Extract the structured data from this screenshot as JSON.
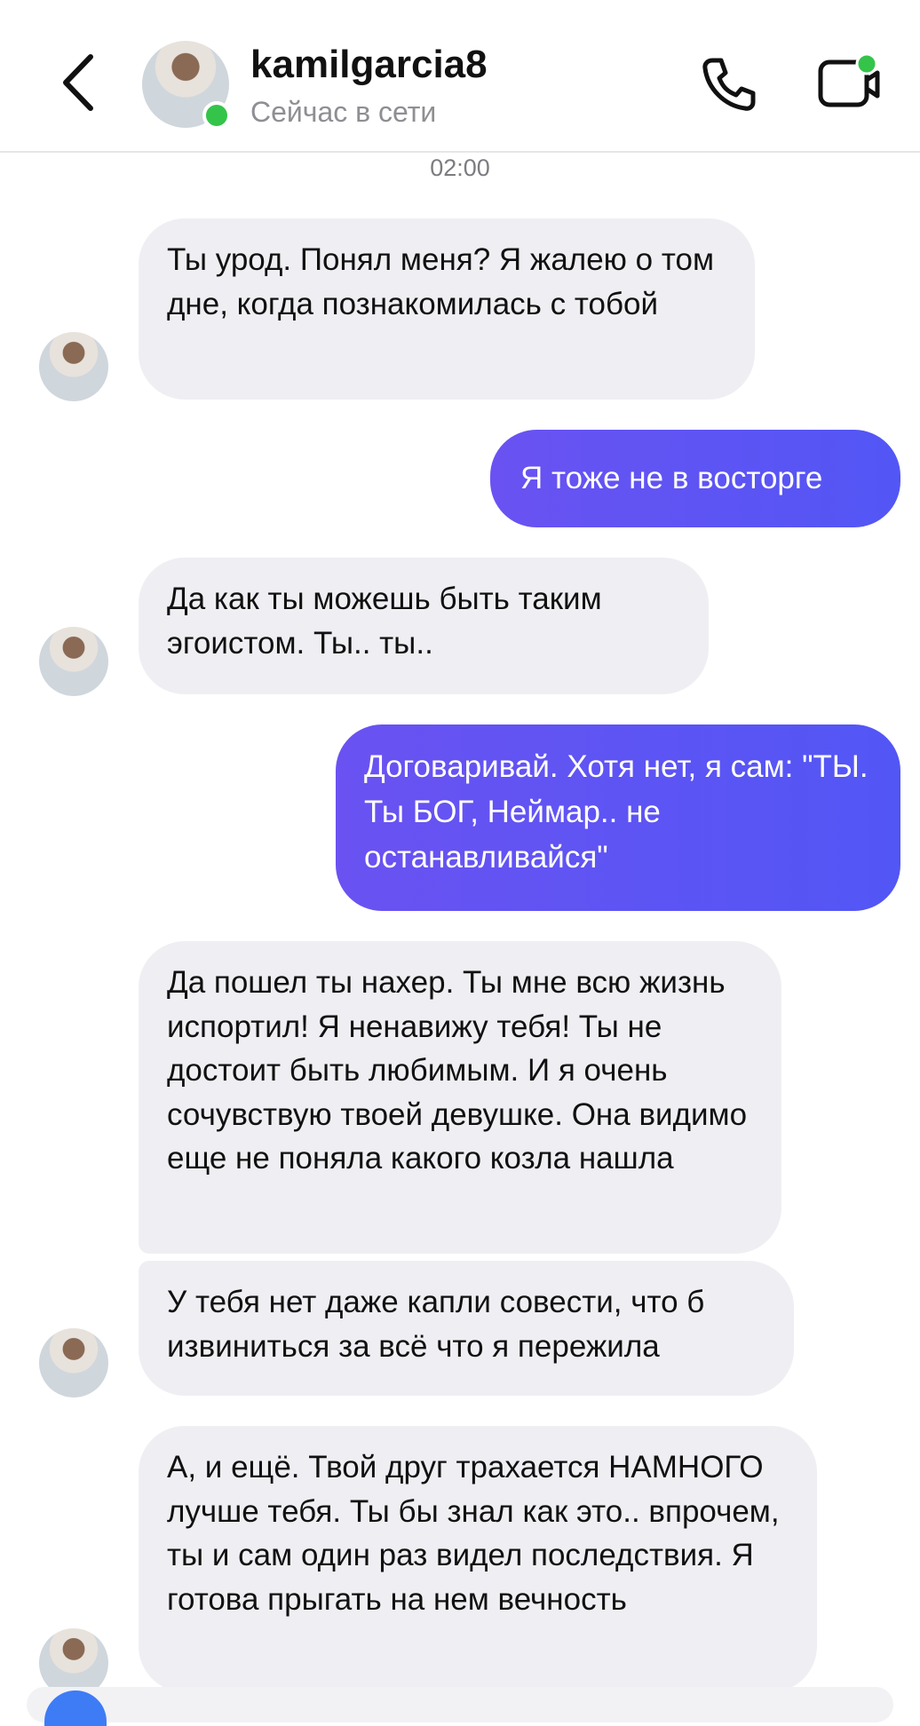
{
  "header": {
    "username": "kamilgarcia8",
    "status": "Сейчас в сети",
    "online_color": "#34c44a",
    "icons": [
      "chevron-left-icon",
      "phone-icon",
      "video-call-icon"
    ]
  },
  "chat": {
    "timestamp": "02:00",
    "messages": [
      {
        "from": "them",
        "text": "Ты урод. Понял меня? Я жалею о том дне, когда познакомилась с тобой"
      },
      {
        "from": "me",
        "text": "Я тоже не в восторге"
      },
      {
        "from": "them",
        "text": "Да как ты можешь быть таким эгоистом. Ты.. ты.."
      },
      {
        "from": "me",
        "text": "Договаривай. Хотя нет, я сам: \"ТЫ. Ты БОГ, Неймар.. не останавливайся\""
      },
      {
        "from": "them",
        "text": "Да пошел ты нахер. Ты мне всю жизнь испортил! Я ненавижу тебя! Ты не достоит быть любимым. И я очень сочувствую твоей девушке. Она видимо еще не поняла какого козла нашла"
      },
      {
        "from": "them",
        "text": "У тебя нет даже капли совести, что б извиниться за всё что я пережила"
      },
      {
        "from": "them",
        "text": "А, и ещё. Твой друг трахается НАМНОГО лучше тебя. Ты бы знал как это.. впрочем, ты и сам один раз видел последствия. Я готова прыгать на нем вечность"
      }
    ]
  },
  "colors": {
    "outgoing_bubble": "#5a55f4",
    "incoming_bubble": "#efeff3"
  }
}
